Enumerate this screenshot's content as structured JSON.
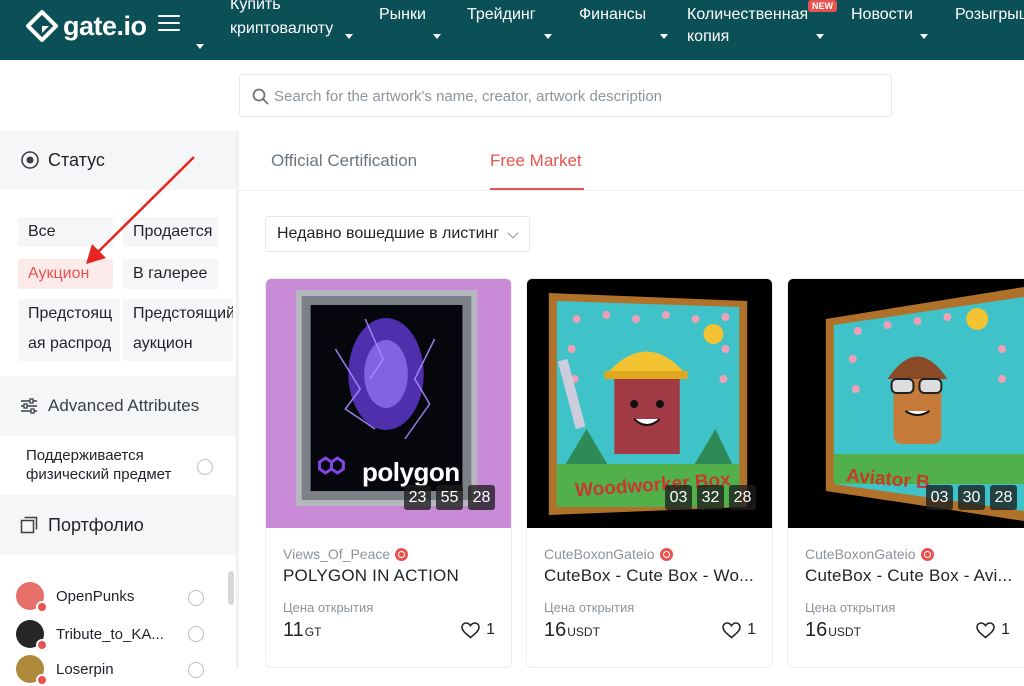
{
  "nav": {
    "logo_text": "gate.io",
    "items": [
      {
        "line1": "Купить",
        "line2": "криптовалюту"
      },
      {
        "label": "Рынки"
      },
      {
        "label": "Трейдинг"
      },
      {
        "label": "Финансы"
      },
      {
        "line1": "Количественная",
        "line2": "копия",
        "badge": "NEW"
      },
      {
        "label": "Новости"
      },
      {
        "label": "Розыгрыш"
      }
    ]
  },
  "search": {
    "placeholder": "Search for the artwork's name, creator, artwork description"
  },
  "sidebar": {
    "status_title": "Статус",
    "status_options": [
      "Все",
      "Продается",
      "Аукцион",
      "В галерее",
      "Предстоящая распродажа",
      "Предстоящий аукцион"
    ],
    "status_selected": "Аукцион",
    "advanced_title": "Advanced Attributes",
    "physical_item": "Поддерживается физический предмет",
    "portfolio_title": "Портфолио",
    "portfolio_items": [
      "OpenPunks",
      "Tribute_to_KA...",
      "Loserpin"
    ]
  },
  "tabs": [
    {
      "label": "Official Certification",
      "active": false
    },
    {
      "label": "Free Market",
      "active": true
    }
  ],
  "sort": {
    "selected": "Недавно вошедшие в листинг"
  },
  "cards": [
    {
      "art_text": "polygon",
      "creator": "Views_Of_Peace",
      "title": "POLYGON IN ACTION",
      "price_label": "Цена открытия",
      "price": "11",
      "currency": "GT",
      "likes": "1",
      "timer": [
        "23",
        "55",
        "28"
      ]
    },
    {
      "art_text": "Woodworker Box",
      "creator": "CuteBoxonGateio",
      "title": "CuteBox - Cute Box - Wo...",
      "price_label": "Цена открытия",
      "price": "16",
      "currency": "USDT",
      "likes": "1",
      "timer": [
        "03",
        "32",
        "28"
      ]
    },
    {
      "art_text": "Aviator B",
      "creator": "CuteBoxonGateio",
      "title": "CuteBox - Cute Box - Avi...",
      "price_label": "Цена открытия",
      "price": "16",
      "currency": "USDT",
      "likes": "1",
      "timer": [
        "03",
        "30",
        "28"
      ]
    }
  ],
  "colors": {
    "nav_bg": "#0b4f57",
    "accent": "#e9534f",
    "sidebar_bg": "#f5f6f7"
  }
}
